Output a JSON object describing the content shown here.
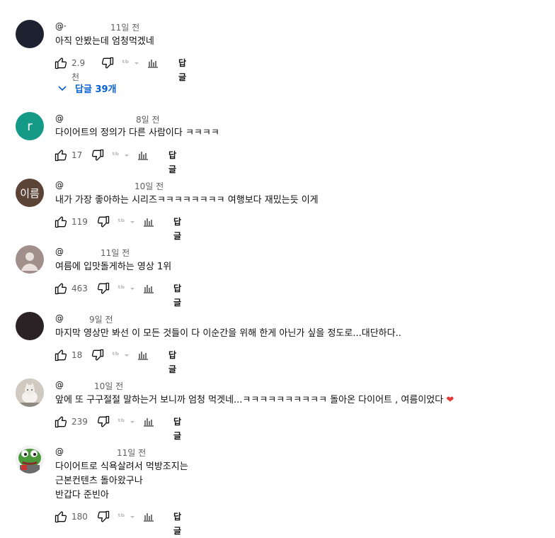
{
  "colors": {
    "accent_blue": "#065fd4",
    "heart": "#e53935"
  },
  "comments": [
    {
      "handle": "@·",
      "time": "11일 전",
      "lines": [
        "아직 안봤는데 엄청먹겠네"
      ],
      "likes": "2.9천",
      "reply_label": "답글",
      "replies_label": "답글 39개",
      "avatar_letter": ""
    },
    {
      "handle": "@",
      "time": "8일 전",
      "lines": [
        "다이어트의 정의가 다른 사람이다 ㅋㅋㅋㅋ"
      ],
      "likes": "17",
      "reply_label": "답글",
      "avatar_letter": "r"
    },
    {
      "handle": "@",
      "time": "10일 전",
      "lines": [
        "내가 가장 좋아하는 시리즈ㅋㅋㅋㅋㅋㅋㅋㅋ 여행보다 재밌는듯 이게"
      ],
      "likes": "119",
      "reply_label": "답글",
      "avatar_letter": "이름"
    },
    {
      "handle": "@",
      "time": "11일 전",
      "lines": [
        "여름에 입맛돌게하는 영상 1위"
      ],
      "likes": "463",
      "reply_label": "답글",
      "avatar_letter": ""
    },
    {
      "handle": "@",
      "time": "9일 전",
      "lines": [
        "마지막 영상만 봐선 이 모든 것들이 다 이순간을 위해 한게 아닌가 싶을 정도로...대단하다.."
      ],
      "likes": "18",
      "reply_label": "답글",
      "avatar_letter": ""
    },
    {
      "handle": "@",
      "time": "10일 전",
      "lines": [
        "앞에 또 구구절절 말하는거 보니까 엄청 먹겟네...ㅋㅋㅋㅋㅋㅋㅋㅋㅋㅋ 돌아온 다이어트 , 여름이었다"
      ],
      "likes": "239",
      "reply_label": "답글",
      "avatar_letter": ""
    },
    {
      "handle": "@",
      "time": "11일 전",
      "lines": [
        "다이어트로 식욕살려서 먹방조지는",
        "근본컨텐츠 돌아왔구나",
        "반갑다 준빈아"
      ],
      "likes": "180",
      "reply_label": "답글",
      "avatar_letter": ""
    }
  ]
}
